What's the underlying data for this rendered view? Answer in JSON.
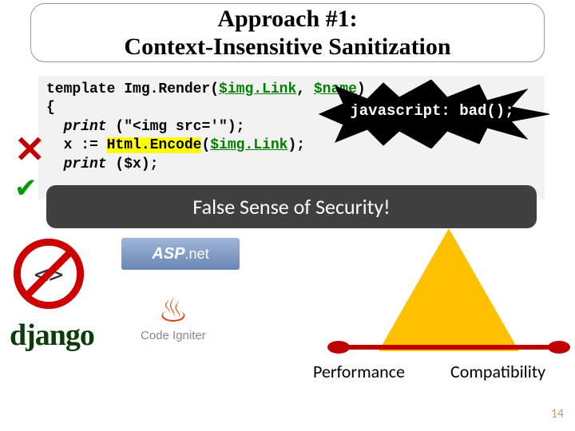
{
  "title": {
    "line1": "Approach #1:",
    "line2": "Context-Insensitive Sanitization"
  },
  "code": {
    "l1_pre": "template Img.Render(",
    "param1": "$img.Link",
    "l1_mid": ", ",
    "param2": "$name",
    "l1_post": ")",
    "l2": "{",
    "l3_a": "  print ",
    "l3_b": "(\"<img src='\");",
    "l4_a": "  x := ",
    "l4_hl": "Html.Encode",
    "l4_b": "(",
    "l4_param": "$img.Link",
    "l4_c": "); ",
    "l5_a": "  print ",
    "l5_b": "($x);"
  },
  "callout": "javascript: bad();",
  "banner": "False Sense of Security!",
  "marks": {
    "x": "✕",
    "check": "✔"
  },
  "logos": {
    "asp": "ASP",
    "net": ".net",
    "django": "django",
    "codeigniter": "Code Igniter"
  },
  "labels": {
    "performance": "Performance",
    "compatibility": "Compatibility"
  },
  "page": "14"
}
